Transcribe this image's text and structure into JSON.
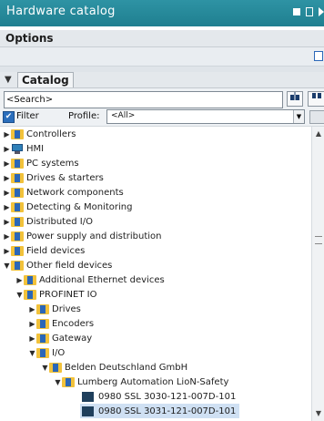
{
  "window": {
    "title": "Hardware catalog",
    "colors": {
      "titlebar": "#2389a0",
      "selection": "#cfe0f3"
    }
  },
  "options": {
    "label": "Options"
  },
  "catalog": {
    "label": "Catalog",
    "search": {
      "value": "<Search>"
    },
    "filter": {
      "label": "Filter",
      "checked": true
    },
    "profile": {
      "label": "Profile:",
      "value": "<All>"
    }
  },
  "tree": [
    {
      "label": "Controllers",
      "expanded": false,
      "icon": "folder-icon"
    },
    {
      "label": "HMI",
      "expanded": false,
      "icon": "hmi-icon"
    },
    {
      "label": "PC systems",
      "expanded": false,
      "icon": "folder-icon"
    },
    {
      "label": "Drives & starters",
      "expanded": false,
      "icon": "folder-icon"
    },
    {
      "label": "Network components",
      "expanded": false,
      "icon": "folder-icon"
    },
    {
      "label": "Detecting & Monitoring",
      "expanded": false,
      "icon": "folder-icon"
    },
    {
      "label": "Distributed I/O",
      "expanded": false,
      "icon": "folder-icon"
    },
    {
      "label": "Power supply and distribution",
      "expanded": false,
      "icon": "folder-icon"
    },
    {
      "label": "Field devices",
      "expanded": false,
      "icon": "folder-icon"
    },
    {
      "label": "Other field devices",
      "expanded": true,
      "icon": "folder-icon"
    },
    {
      "label": "Additional Ethernet devices",
      "expanded": false,
      "icon": "folder-icon"
    },
    {
      "label": "PROFINET IO",
      "expanded": true,
      "icon": "folder-icon"
    },
    {
      "label": "Drives",
      "expanded": false,
      "icon": "folder-icon"
    },
    {
      "label": "Encoders",
      "expanded": false,
      "icon": "folder-icon"
    },
    {
      "label": "Gateway",
      "expanded": false,
      "icon": "folder-icon"
    },
    {
      "label": "I/O",
      "expanded": true,
      "icon": "folder-icon"
    },
    {
      "label": "Belden Deutschland GmbH",
      "expanded": true,
      "icon": "folder-icon"
    },
    {
      "label": "Lumberg Automation LioN-Safety",
      "expanded": true,
      "icon": "folder-icon"
    },
    {
      "label": "0980 SSL 3030-121-007D-101",
      "icon": "module-icon"
    },
    {
      "label": "0980 SSL 3031-121-007D-101",
      "icon": "module-icon",
      "selected": true
    }
  ]
}
